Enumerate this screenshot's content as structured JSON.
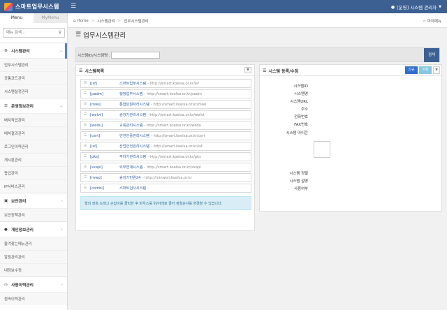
{
  "app": {
    "title": "스마트업무시스템",
    "user_label": "[운영] 시스템 관리자"
  },
  "sidebar": {
    "tabs": [
      "Menu",
      "MyMenu"
    ],
    "search_placeholder": "메뉴 검색...",
    "sections": [
      {
        "label": "시스템관리",
        "icon": "gear-icon",
        "open": true,
        "items": [
          "업무시스템관리",
          "공통코드관리",
          "시스템설정관리"
        ]
      },
      {
        "label": "운영정보관리",
        "icon": "list-icon",
        "open": true,
        "items": [
          "배치작업관리",
          "배치결과관리",
          "로그인이력관리",
          "게시판관리",
          "팝업관리",
          "IP서비스관리"
        ]
      },
      {
        "label": "보안관리",
        "icon": "lock-icon",
        "open": false,
        "items": [
          "보안정책관리"
        ]
      },
      {
        "label": "개인정보관리",
        "icon": "user-icon",
        "open": false,
        "items": [
          "즐겨찾는메뉴관리",
          "알림관리관리",
          "내정보수정"
        ]
      },
      {
        "label": "사용이력관리",
        "icon": "history-icon",
        "open": false,
        "items": [
          "접속이력관리"
        ]
      }
    ]
  },
  "header": {
    "breadcrumb": [
      "Home",
      "시스템관리",
      "업무시스템관리"
    ],
    "favorite": "마이메뉴"
  },
  "page": {
    "title": "업무시스템관리"
  },
  "search": {
    "label": "시스템ID/시스템명 :",
    "button": "검색"
  },
  "list_panel": {
    "title": "시스템목록",
    "rows": [
      {
        "code": "[jsf]",
        "name": "스마트업무시스템",
        "url": "- http://smart.koelsa.or.kr/jsf"
      },
      {
        "code": "[padm]",
        "name": "행정업무시스템",
        "url": "- http://smart.koelsa.or.kr/padm"
      },
      {
        "code": "[mws]",
        "name": "통합민원처리시스템",
        "url": "- http://smart.koelsa.or.kr/mws"
      },
      {
        "code": "[welvt]",
        "name": "승강기관리시스템",
        "url": "- http://smart.koelsa.or.kr/welvt"
      },
      {
        "code": "[wedu]",
        "name": "교육관리시스템",
        "url": "- http://smart.koelsa.or.kr/wedu"
      },
      {
        "code": "[cert]",
        "name": "안전인증관리시스템",
        "url": "- http://smart.koelsa.or.kr/cert"
      },
      {
        "code": "[isf]",
        "name": "산업안전관리시스템",
        "url": "- http://smart.koelsa.or.kr/isf"
      },
      {
        "code": "[pks]",
        "name": "주차기관리시스템",
        "url": "- http://smart.koelsa.or.kr/pks"
      },
      {
        "code": "[sxapi]",
        "name": "외부연계시스템",
        "url": "- http://smart.koelsa.or.kr/sxapi"
      },
      {
        "code": "[mwp]",
        "name": "승강기민원24",
        "url": "- http://minwon.koelsa.or.kr"
      },
      {
        "code": "[combi]",
        "name": "스마트검사시스템",
        "url": "-"
      }
    ],
    "notice": "행의 좌측 드래그 손잡이를 클릭한 후 마우스를 위/아래로 끌어 정렬순서를 변경할 수 있습니다."
  },
  "form_panel": {
    "title": "시스템 등록/수정",
    "buttons": {
      "new": "신규",
      "save": "저장"
    },
    "fields": [
      "시스템ID",
      "시스템명",
      "시스템URL",
      "주소",
      "전화번호",
      "FAX번호",
      "시스템 아이콘",
      "시스템 정렬",
      "시스템 설명",
      "사용여부"
    ]
  }
}
